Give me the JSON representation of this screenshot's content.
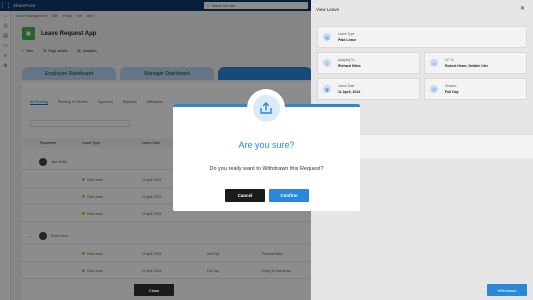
{
  "suite": {
    "brand": "SharePoint",
    "search_placeholder": "Search this site"
  },
  "breadcrumb": [
    "Leave Management",
    "Site",
    "Flows",
    "Lib",
    "Info"
  ],
  "app": {
    "title": "Leave Request App"
  },
  "commands": {
    "new": "New",
    "page_details": "Page details",
    "analytics": "Analytics"
  },
  "tabs": [
    {
      "label": "Employee Dashboard"
    },
    {
      "label": "Manager Dashboard"
    },
    {
      "label": ""
    }
  ],
  "subtabs": [
    "All Pending",
    "Pending To Review",
    "Approved",
    "Rejected",
    "Withdrawn"
  ],
  "table": {
    "headers": [
      "Requester",
      "Leave Type",
      "Leave Date"
    ],
    "groups": [
      {
        "name": "Jane Smith",
        "rows": [
          {
            "type": "Paid Leave",
            "date": "11 April, 2024"
          },
          {
            "type": "Paid Leave",
            "date": "11 April, 2024"
          },
          {
            "type": "Paid Leave",
            "date": "11 April, 2024"
          }
        ]
      },
      {
        "name": "Robin Hood",
        "rows": [
          {
            "type": "Paid Leave",
            "date": "11 April, 2024",
            "extra1": "Half Day",
            "extra2": "Personal Work"
          },
          {
            "type": "Paid Leave",
            "date": "11 April, 2024",
            "extra1": "Full Day",
            "extra2": "Going To Hometown"
          }
        ]
      }
    ]
  },
  "sidepane": {
    "title": "View Leave",
    "fields": {
      "leave_type": {
        "label": "Leave Type",
        "value": "Paid Leave"
      },
      "applying_to": {
        "label": "Applying To",
        "value": "Richard Miles"
      },
      "cc_to": {
        "label": "CC To",
        "value": "Robert Howe, Debbie Uler"
      },
      "leave_date": {
        "label": "Leave Date",
        "value": "11 April, 2024"
      },
      "session": {
        "label": "Session",
        "value": "Full Day"
      }
    },
    "close_label": "Close",
    "withdrawn_label": "Withdrawn"
  },
  "dialog": {
    "title": "Are you sure?",
    "message": "Do you really want to Withdrawn this Request?",
    "cancel_label": "Cancel",
    "confirm_label": "Confirm"
  },
  "colors": {
    "accent": "#2b88d8",
    "suite": "#0f3a6e",
    "dark_button": "#1b1b1b"
  },
  "icons": {
    "dialog": "upload-share-icon"
  }
}
